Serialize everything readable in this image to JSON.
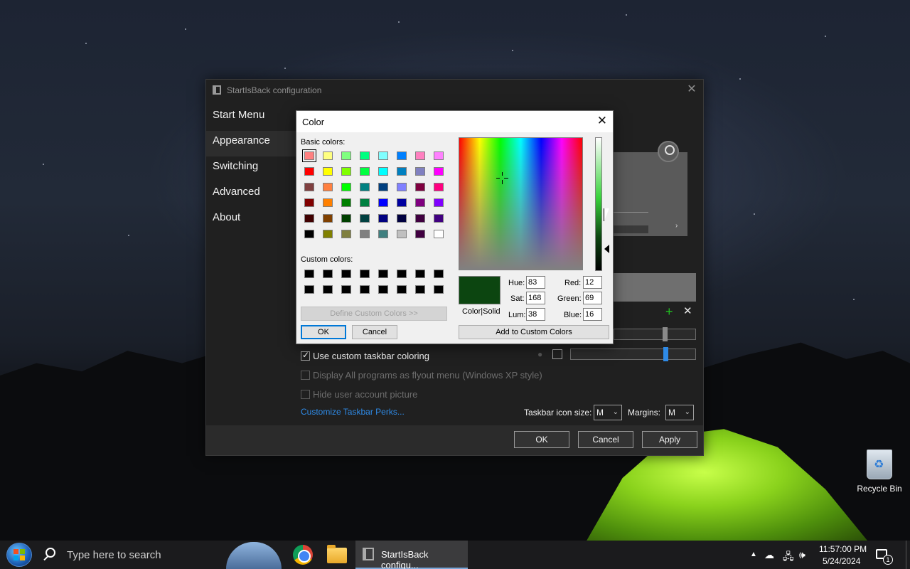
{
  "desktop": {
    "recycle_bin_label": "Recycle Bin"
  },
  "main_window": {
    "title": "StartIsBack configuration",
    "nav": [
      "Start Menu",
      "Appearance",
      "Switching",
      "Advanced",
      "About"
    ],
    "active_nav": "Appearance",
    "options": {
      "custom_taskbar_coloring": {
        "label": "Use custom taskbar coloring",
        "checked": true
      },
      "all_programs_flyout": {
        "label": "Display All programs as flyout menu (Windows XP style)",
        "checked": false,
        "disabled": true
      },
      "hide_user_picture": {
        "label": "Hide user account picture",
        "checked": false,
        "disabled": true
      }
    },
    "customize_link": "Customize Taskbar Perks...",
    "taskbar_icon_size_label": "Taskbar icon size:",
    "taskbar_icon_size_value": "M",
    "margins_label": "Margins:",
    "margins_value": "M",
    "buttons": {
      "ok": "OK",
      "cancel": "Cancel",
      "apply": "Apply"
    },
    "colors": {
      "link": "#2e8ae6",
      "slider_thumb": "#2e8ae6",
      "add_icon": "#20c020"
    }
  },
  "color_dialog": {
    "title": "Color",
    "basic_colors_label": "Basic colors:",
    "custom_colors_label": "Custom colors:",
    "basic_colors": [
      [
        "#ff8080",
        "#ffff80",
        "#80ff80",
        "#00ff80",
        "#80ffff",
        "#0080ff",
        "#ff80c0",
        "#ff80ff"
      ],
      [
        "#ff0000",
        "#ffff00",
        "#80ff00",
        "#00ff40",
        "#00ffff",
        "#0080c0",
        "#8080c0",
        "#ff00ff"
      ],
      [
        "#804040",
        "#ff8040",
        "#00ff00",
        "#008080",
        "#004080",
        "#8080ff",
        "#800040",
        "#ff0080"
      ],
      [
        "#800000",
        "#ff8000",
        "#008000",
        "#008040",
        "#0000ff",
        "#0000a0",
        "#800080",
        "#8000ff"
      ],
      [
        "#400000",
        "#804000",
        "#004000",
        "#004040",
        "#000080",
        "#000040",
        "#400040",
        "#400080"
      ],
      [
        "#000000",
        "#808000",
        "#808040",
        "#808080",
        "#408080",
        "#c0c0c0",
        "#400040",
        "#ffffff"
      ]
    ],
    "selected_basic_color": "#ff8080",
    "custom_colors": [
      [
        "#000000",
        "#000000",
        "#000000",
        "#000000",
        "#000000",
        "#000000",
        "#000000",
        "#000000"
      ],
      [
        "#000000",
        "#000000",
        "#000000",
        "#000000",
        "#000000",
        "#000000",
        "#000000",
        "#000000"
      ]
    ],
    "define_custom_colors_label": "Define Custom Colors >>",
    "ok_label": "OK",
    "cancel_label": "Cancel",
    "color_solid_label": "Color|Solid",
    "current_color": "#0c4510",
    "fields": {
      "hue": {
        "label": "Hue:",
        "value": "83"
      },
      "sat": {
        "label": "Sat:",
        "value": "168"
      },
      "lum": {
        "label": "Lum:",
        "value": "38"
      },
      "red": {
        "label": "Red:",
        "value": "12"
      },
      "green": {
        "label": "Green:",
        "value": "69"
      },
      "blue": {
        "label": "Blue:",
        "value": "16"
      }
    },
    "add_to_custom_label": "Add to Custom Colors"
  },
  "taskbar": {
    "search_placeholder": "Type here to search",
    "active_task_label": "StartIsBack configu...",
    "clock_time": "11:57:00 PM",
    "clock_date": "5/24/2024",
    "notification_count": "1",
    "icons": [
      "start-orb-icon",
      "search-icon",
      "bridge-app-icon",
      "chrome-icon",
      "file-explorer-icon",
      "startisback-icon",
      "show-hidden-icons-icon",
      "onedrive-icon",
      "network-icon",
      "volume-icon",
      "action-center-icon"
    ]
  }
}
